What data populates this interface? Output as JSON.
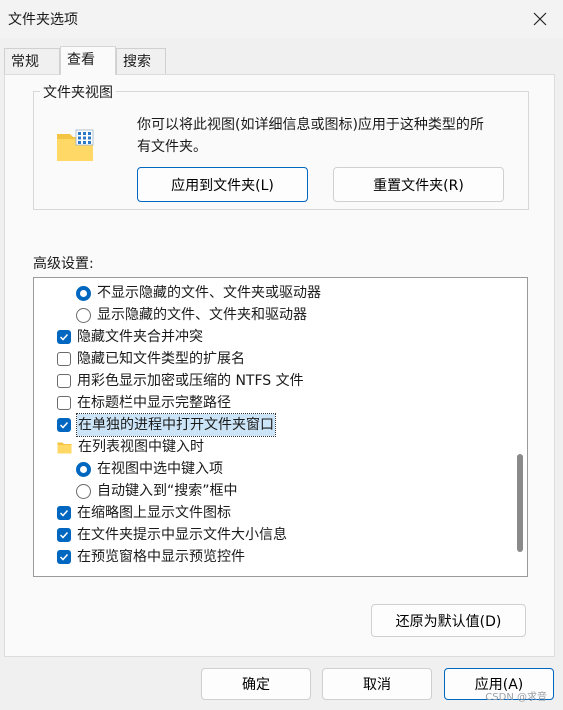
{
  "window": {
    "title": "文件夹选项"
  },
  "tabs": [
    {
      "label": "常规"
    },
    {
      "label": "查看"
    },
    {
      "label": "搜索"
    }
  ],
  "folder_views": {
    "title": "文件夹视图",
    "description_line1": "你可以将此视图(如详细信息或图标)应用于这种类型的所",
    "description_line2": "有文件夹。",
    "apply_button": "应用到文件夹(L)",
    "reset_button": "重置文件夹(R)"
  },
  "advanced": {
    "label": "高级设置:",
    "items": [
      {
        "type": "radio",
        "checked": true,
        "label": "不显示隐藏的文件、文件夹或驱动器"
      },
      {
        "type": "radio",
        "checked": false,
        "label": "显示隐藏的文件、文件夹和驱动器"
      },
      {
        "type": "checkbox",
        "checked": true,
        "label": "隐藏文件夹合并冲突"
      },
      {
        "type": "checkbox",
        "checked": false,
        "label": "隐藏已知文件类型的扩展名"
      },
      {
        "type": "checkbox",
        "checked": false,
        "label": "用彩色显示加密或压缩的 NTFS 文件"
      },
      {
        "type": "checkbox",
        "checked": false,
        "label": "在标题栏中显示完整路径"
      },
      {
        "type": "checkbox",
        "checked": true,
        "label": "在单独的进程中打开文件夹窗口"
      },
      {
        "type": "folder",
        "label": "在列表视图中键入时"
      },
      {
        "type": "radio",
        "checked": true,
        "label": "在视图中选中键入项"
      },
      {
        "type": "radio",
        "checked": false,
        "label": "自动键入到“搜索”框中"
      },
      {
        "type": "checkbox",
        "checked": true,
        "label": "在缩略图上显示文件图标"
      },
      {
        "type": "checkbox",
        "checked": true,
        "label": "在文件夹提示中显示文件大小信息"
      },
      {
        "type": "checkbox",
        "checked": true,
        "label": "在预览窗格中显示预览控件"
      }
    ],
    "restore_button": "还原为默认值(D)"
  },
  "footer": {
    "ok": "确定",
    "cancel": "取消",
    "apply": "应用(A)"
  },
  "watermark": "CSDN @求音",
  "colors": {
    "accent": "#0067c0",
    "selection": "#cce4f7"
  }
}
